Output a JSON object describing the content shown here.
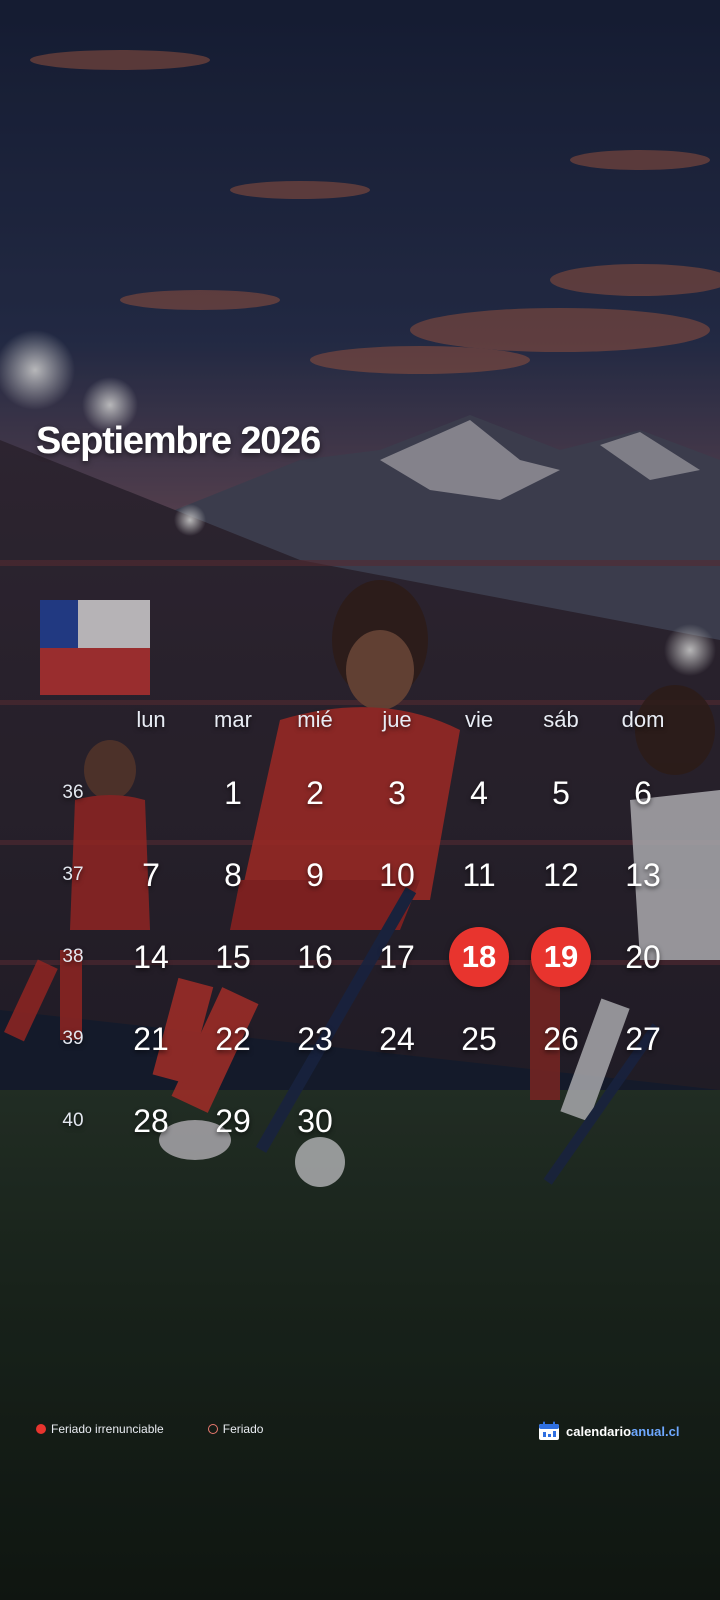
{
  "title": "Septiembre 2026",
  "weekdays": [
    "lun",
    "mar",
    "mié",
    "jue",
    "vie",
    "sáb",
    "dom"
  ],
  "weeks": [
    {
      "number": "36",
      "days": [
        "",
        "1",
        "2",
        "3",
        "4",
        "5",
        "6"
      ]
    },
    {
      "number": "37",
      "days": [
        "7",
        "8",
        "9",
        "10",
        "11",
        "12",
        "13"
      ]
    },
    {
      "number": "38",
      "days": [
        "14",
        "15",
        "16",
        "17",
        "18",
        "19",
        "20"
      ]
    },
    {
      "number": "39",
      "days": [
        "21",
        "22",
        "23",
        "24",
        "25",
        "26",
        "27"
      ]
    },
    {
      "number": "40",
      "days": [
        "28",
        "29",
        "30",
        "",
        "",
        "",
        ""
      ]
    }
  ],
  "holidays_irrenunciables": [
    "18",
    "19"
  ],
  "legend": {
    "irrenunciable": "Feriado irrenunciable",
    "feriado": "Feriado"
  },
  "brand": {
    "name": "calendario",
    "accent": "anual.cl"
  },
  "colors": {
    "holiday": "#e8342e",
    "brand_accent": "#6ea8ff"
  },
  "icons": {
    "brand": "calendar-icon",
    "legend_irrenunciable": "filled-dot-icon",
    "legend_feriado": "ring-dot-icon"
  }
}
